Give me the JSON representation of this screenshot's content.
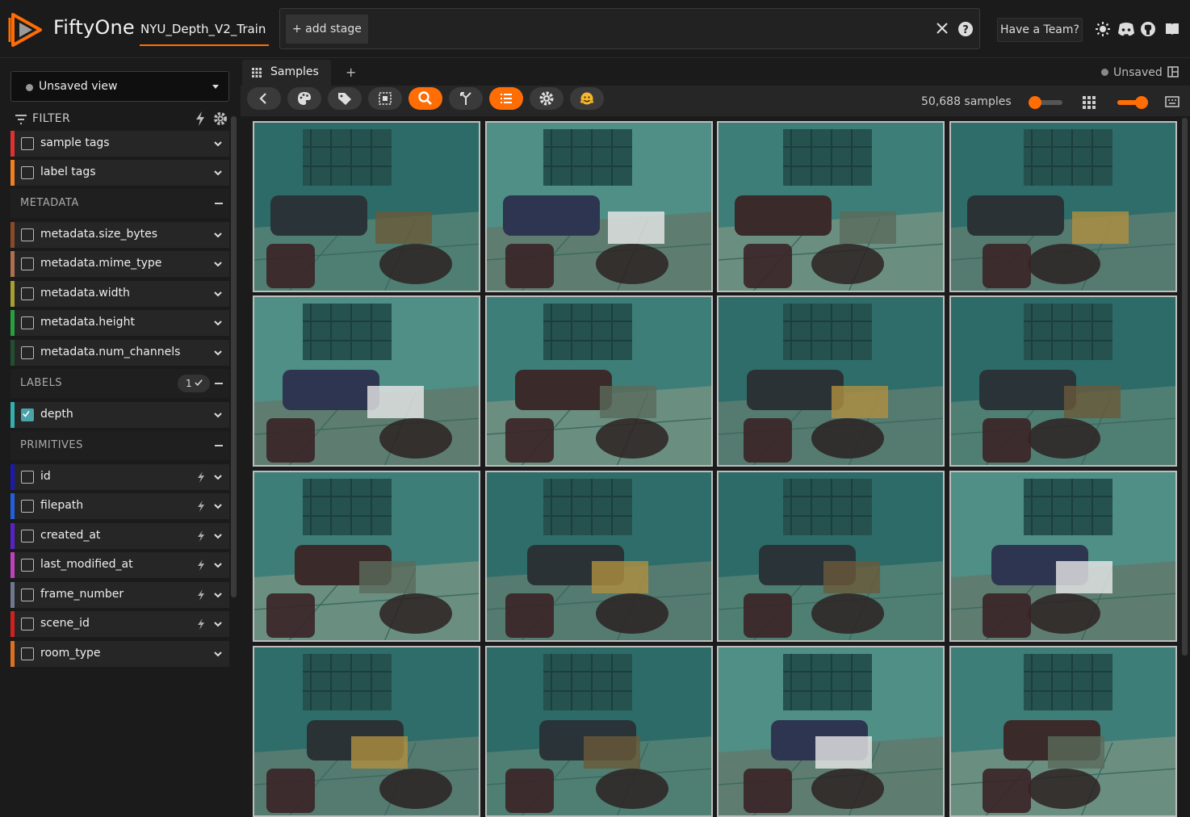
{
  "header": {
    "brand": "FiftyOne",
    "dataset_name": "NYU_Depth_V2_Train",
    "add_stage": "+ add stage",
    "team_button": "Have a Team?",
    "icons": [
      "close-icon",
      "help-icon",
      "sun-icon",
      "discord-icon",
      "github-icon",
      "book-icon"
    ]
  },
  "sidebar": {
    "view_select": "Unsaved view",
    "filter_label": "FILTER",
    "rows_top": [
      {
        "label": "sample tags",
        "color": "#e03030"
      },
      {
        "label": "label tags",
        "color": "#f08020"
      }
    ],
    "groups": {
      "metadata": "METADATA",
      "labels": "LABELS",
      "labels_count": "1",
      "primitives": "PRIMITIVES"
    },
    "metadata_rows": [
      {
        "label": "metadata.size_bytes",
        "color": "#8a4a28"
      },
      {
        "label": "metadata.mime_type",
        "color": "#b07050"
      },
      {
        "label": "metadata.width",
        "color": "#a8a030"
      },
      {
        "label": "metadata.height",
        "color": "#28a040"
      },
      {
        "label": "metadata.num_channels",
        "color": "#205030"
      }
    ],
    "label_rows": [
      {
        "label": "depth",
        "color": "#30b0b0",
        "checked": true
      }
    ],
    "primitive_rows": [
      {
        "label": "id",
        "color": "#1a1ab0"
      },
      {
        "label": "filepath",
        "color": "#2060e0"
      },
      {
        "label": "created_at",
        "color": "#5a20d0"
      },
      {
        "label": "last_modified_at",
        "color": "#c040c0"
      },
      {
        "label": "frame_number",
        "color": "#707890"
      },
      {
        "label": "scene_id",
        "color": "#d02020"
      },
      {
        "label": "room_type",
        "color": "#e07020"
      }
    ]
  },
  "main": {
    "tab_label": "Samples",
    "tab_add": "+",
    "unsaved": "Unsaved",
    "sample_count": "50,688 samples",
    "toolbar_buttons": [
      "back-icon",
      "palette-icon",
      "tag-icon",
      "select-icon",
      "search-icon",
      "merge-icon",
      "list-icon",
      "settings-icon",
      "emoji-icon"
    ],
    "tile_count": 16
  }
}
